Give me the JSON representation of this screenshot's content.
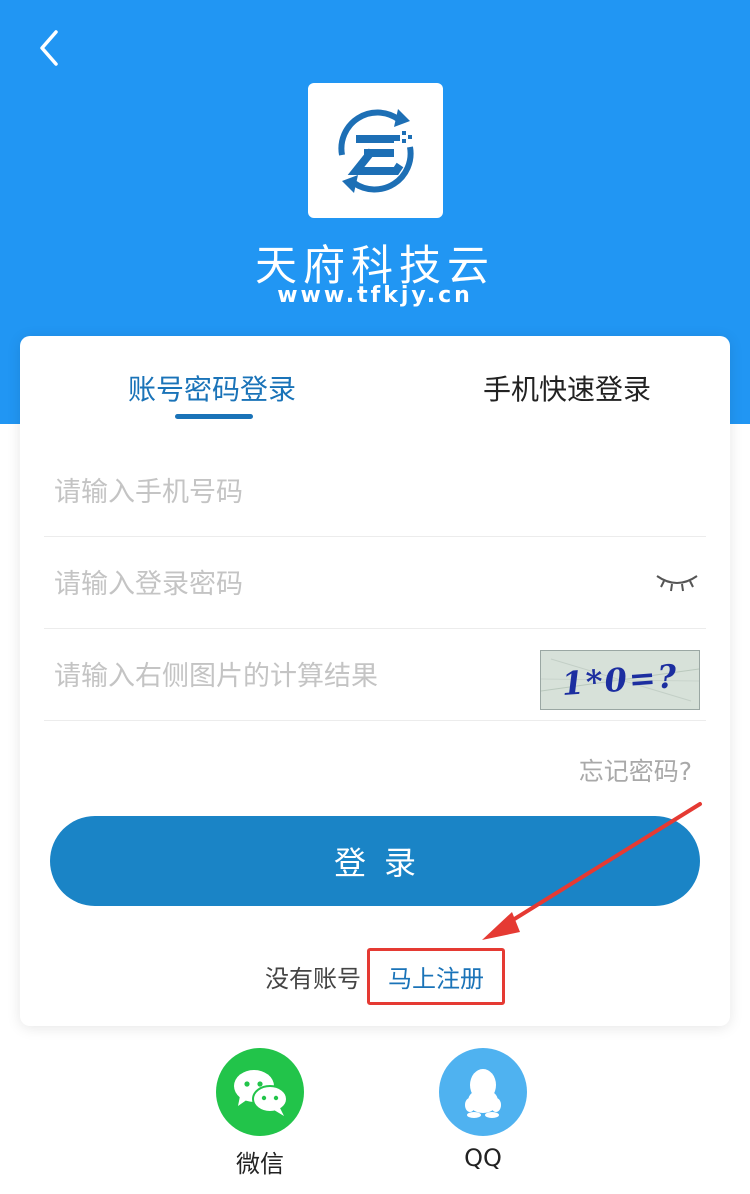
{
  "header": {
    "brand_name": "天府科技云",
    "brand_url": "www.tfkjy.cn"
  },
  "tabs": {
    "account_login": "账号密码登录",
    "phone_login": "手机快速登录"
  },
  "form": {
    "phone_placeholder": "请输入手机号码",
    "password_placeholder": "请输入登录密码",
    "captcha_placeholder": "请输入右侧图片的计算结果",
    "captcha_text": "1*0=?",
    "forgot_password": "忘记密码?",
    "login_button": "登录"
  },
  "register": {
    "prompt": "没有账号",
    "link": "马上注册"
  },
  "social": {
    "wechat_label": "微信",
    "qq_label": "QQ"
  },
  "colors": {
    "header_bg": "#2196f3",
    "accent": "#1a84c6",
    "highlight_red": "#e53a33",
    "wechat_green": "#22c44a",
    "qq_blue": "#4fb2f0"
  }
}
